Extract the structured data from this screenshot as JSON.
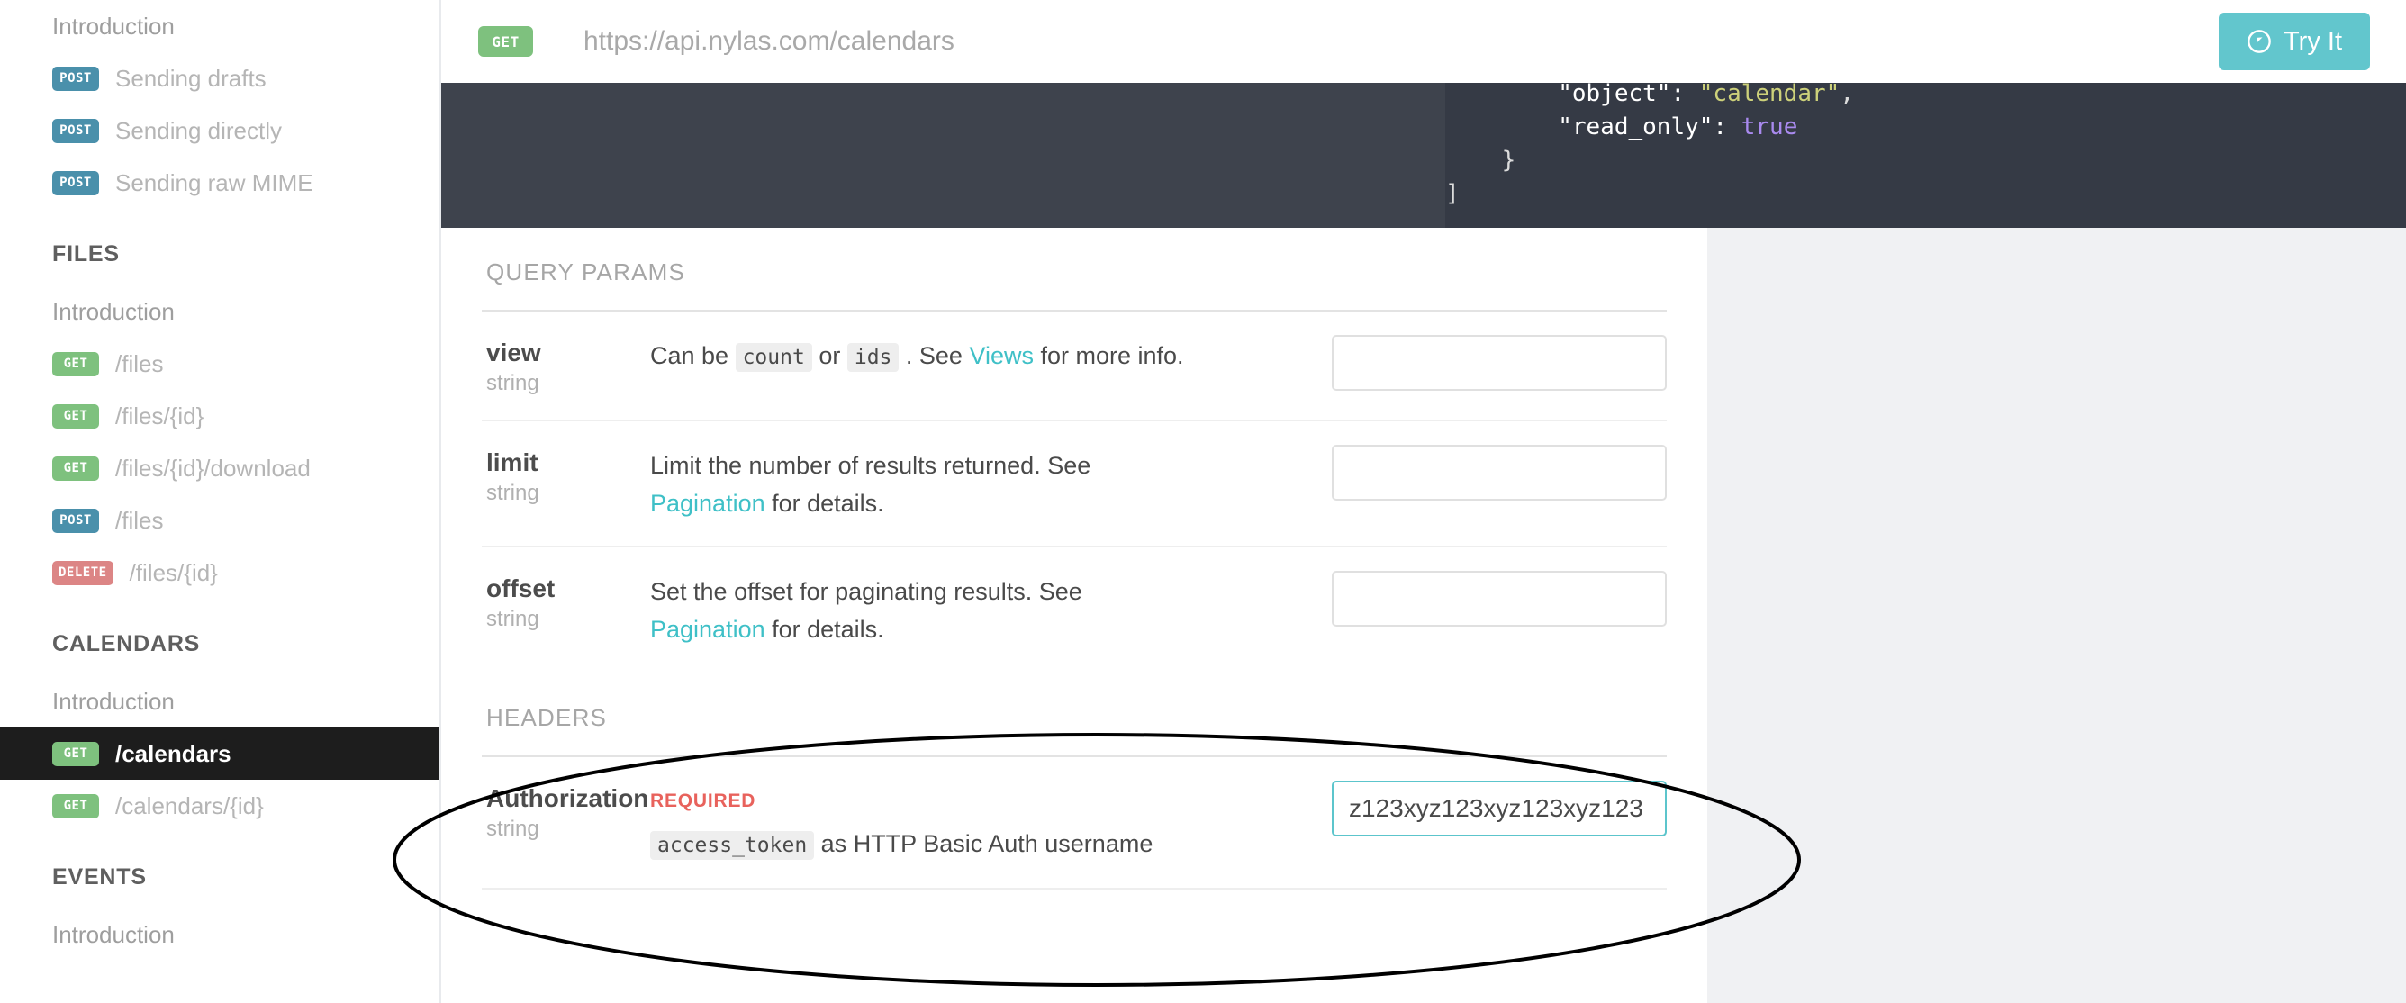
{
  "sidebar": {
    "items": [
      {
        "type": "plain",
        "label": "Introduction"
      },
      {
        "type": "method",
        "method": "POST",
        "label": "Sending drafts"
      },
      {
        "type": "method",
        "method": "POST",
        "label": "Sending directly"
      },
      {
        "type": "method",
        "method": "POST",
        "label": "Sending raw MIME"
      },
      {
        "type": "section",
        "label": "FILES"
      },
      {
        "type": "plain",
        "label": "Introduction"
      },
      {
        "type": "method",
        "method": "GET",
        "label": "/files"
      },
      {
        "type": "method",
        "method": "GET",
        "label": "/files/{id}"
      },
      {
        "type": "method",
        "method": "GET",
        "label": "/files/{id}/download"
      },
      {
        "type": "method",
        "method": "POST",
        "label": "/files"
      },
      {
        "type": "method",
        "method": "DELETE",
        "label": "/files/{id}"
      },
      {
        "type": "section",
        "label": "CALENDARS"
      },
      {
        "type": "plain",
        "label": "Introduction"
      },
      {
        "type": "method",
        "method": "GET",
        "label": "/calendars",
        "active": true
      },
      {
        "type": "method",
        "method": "GET",
        "label": "/calendars/{id}"
      },
      {
        "type": "section",
        "label": "EVENTS"
      },
      {
        "type": "plain",
        "label": "Introduction"
      }
    ]
  },
  "topbar": {
    "method": "GET",
    "url": "https://api.nylas.com/calendars",
    "try_it_label": "Try It",
    "try_it_icon": "play-circle-icon",
    "accent_color": "#62c6cd"
  },
  "code_panel": {
    "lines": [
      {
        "segments": [
          {
            "t": "        \"object\": ",
            "c": "tok-key"
          },
          {
            "t": "\"calendar\"",
            "c": "tok-str"
          },
          {
            "t": ",",
            "c": "tok-pun"
          }
        ]
      },
      {
        "segments": [
          {
            "t": "        \"read_only\": ",
            "c": "tok-key"
          },
          {
            "t": "true",
            "c": "tok-bool"
          }
        ]
      },
      {
        "segments": [
          {
            "t": "    }",
            "c": "tok-pun"
          }
        ]
      },
      {
        "segments": [
          {
            "t": "]",
            "c": "tok-pun"
          }
        ]
      }
    ]
  },
  "query_params": {
    "label": "QUERY PARAMS",
    "rows": [
      {
        "name": "view",
        "type": "string",
        "desc_html": "Can be <code class=\"inline\">count</code> or <code class=\"inline\">ids</code> . See <span class=\"lnk\">Views</span> for more info.",
        "value": "",
        "placeholder": ""
      },
      {
        "name": "limit",
        "type": "string",
        "desc_html": "Limit the number of results returned. See <span class=\"lnk\">Pagination</span> for details.",
        "value": "",
        "placeholder": ""
      },
      {
        "name": "offset",
        "type": "string",
        "desc_html": "Set the offset for paginating results. See <span class=\"lnk\">Pagination</span> for details.",
        "value": "",
        "placeholder": ""
      }
    ]
  },
  "headers": {
    "label": "HEADERS",
    "rows": [
      {
        "name": "Authorization",
        "type": "string",
        "required_label": "REQUIRED",
        "desc_html": "<code class=\"inline\">access_token</code> as HTTP Basic Auth username",
        "value": "z123xyz123xyz123xyz123",
        "placeholder": "",
        "focused": true
      }
    ]
  },
  "annotation": {
    "shape": "ellipse-highlight",
    "color": "#000000"
  }
}
